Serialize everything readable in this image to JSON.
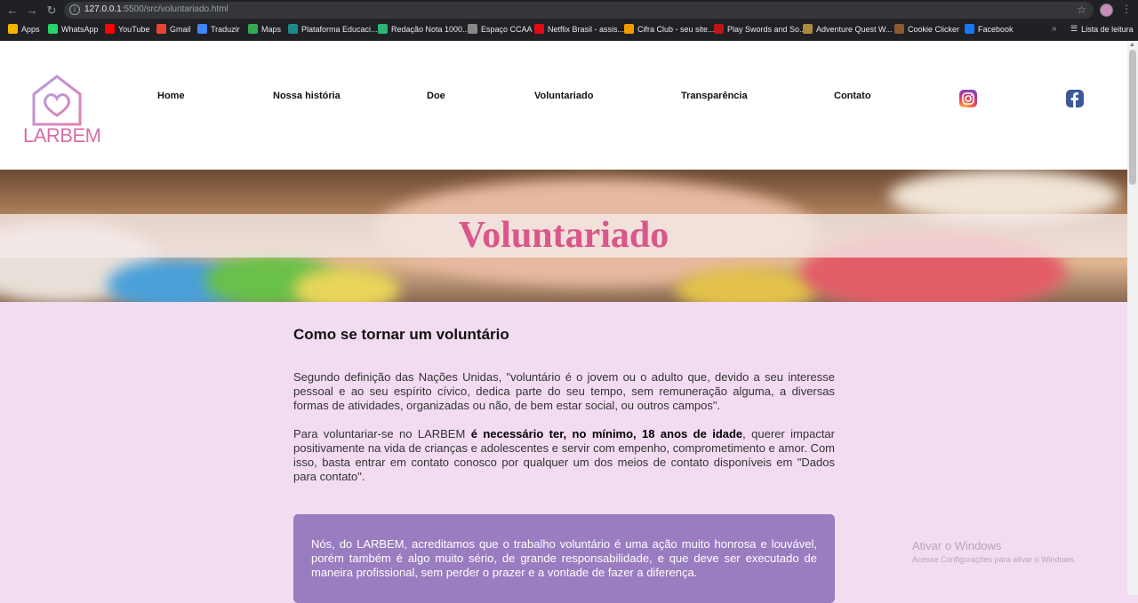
{
  "browser": {
    "url_host": "127.0.0.1",
    "url_rest": ":5500/src/voluntariado.html",
    "bookmarks": [
      {
        "label": "Apps",
        "color": "#f4b400"
      },
      {
        "label": "WhatsApp",
        "color": "#25d366"
      },
      {
        "label": "YouTube",
        "color": "#ff0000"
      },
      {
        "label": "Gmail",
        "color": "#ea4335"
      },
      {
        "label": "Traduzir",
        "color": "#4285f4"
      },
      {
        "label": "Maps",
        "color": "#34a853"
      },
      {
        "label": "Plataforma Educaci...",
        "color": "#1e8a8a"
      },
      {
        "label": "Redação Nota 1000...",
        "color": "#2bb673"
      },
      {
        "label": "Espaço CCAA",
        "color": "#888888"
      },
      {
        "label": "Netflix Brasil - assis...",
        "color": "#e50914"
      },
      {
        "label": "Cifra Club - seu site...",
        "color": "#f59b00"
      },
      {
        "label": "Play Swords and So...",
        "color": "#c0141b"
      },
      {
        "label": "Adventure Quest W...",
        "color": "#b08a3c"
      },
      {
        "label": "Cookie Clicker",
        "color": "#8b5a2b"
      },
      {
        "label": "Facebook",
        "color": "#1877f2"
      }
    ],
    "more": "»",
    "reading_list": "Lista de leitura"
  },
  "header": {
    "logo_text": "LARBEM",
    "nav": [
      "Home",
      "Nossa história",
      "Doe",
      "Voluntariado",
      "Transparência",
      "Contato"
    ]
  },
  "banner": {
    "title": "Voluntariado"
  },
  "content": {
    "heading": "Como se tornar um voluntário",
    "para1": "Segundo definição das Nações Unidas, \"voluntário é o jovem ou o adulto que, devido a seu interesse pessoal e ao seu espírito cívico, dedica parte do seu tempo, sem remuneração alguma, a diversas formas de atividades, organizadas ou não, de bem estar social, ou outros campos\".",
    "para2_before": "Para voluntariar-se no LARBEM ",
    "para2_bold": "é necessário ter, no mínimo, 18 anos de idade",
    "para2_after": ", querer impactar positivamente na vida de crianças e adolescentes e servir com empenho, comprometimento e amor. Com isso, basta entrar em contato conosco por qualquer um dos meios de contato disponíveis em \"Dados para contato\".",
    "quote": "Nós, do LARBEM, acreditamos que o trabalho voluntário é uma ação muito honrosa e louvável, porém também é algo muito sério, de grande responsabilidade, e que deve ser executado de maneira profissional, sem perder o prazer e a vontade de fazer a diferença."
  },
  "watermark": {
    "line1": "Ativar o Windows",
    "line2": "Acesse Configurações para ativar o Windows."
  },
  "colors": {
    "page_bg": "#f3dcf1",
    "accent_pink": "#d9578a",
    "quote_bg": "#9a7cc0"
  }
}
